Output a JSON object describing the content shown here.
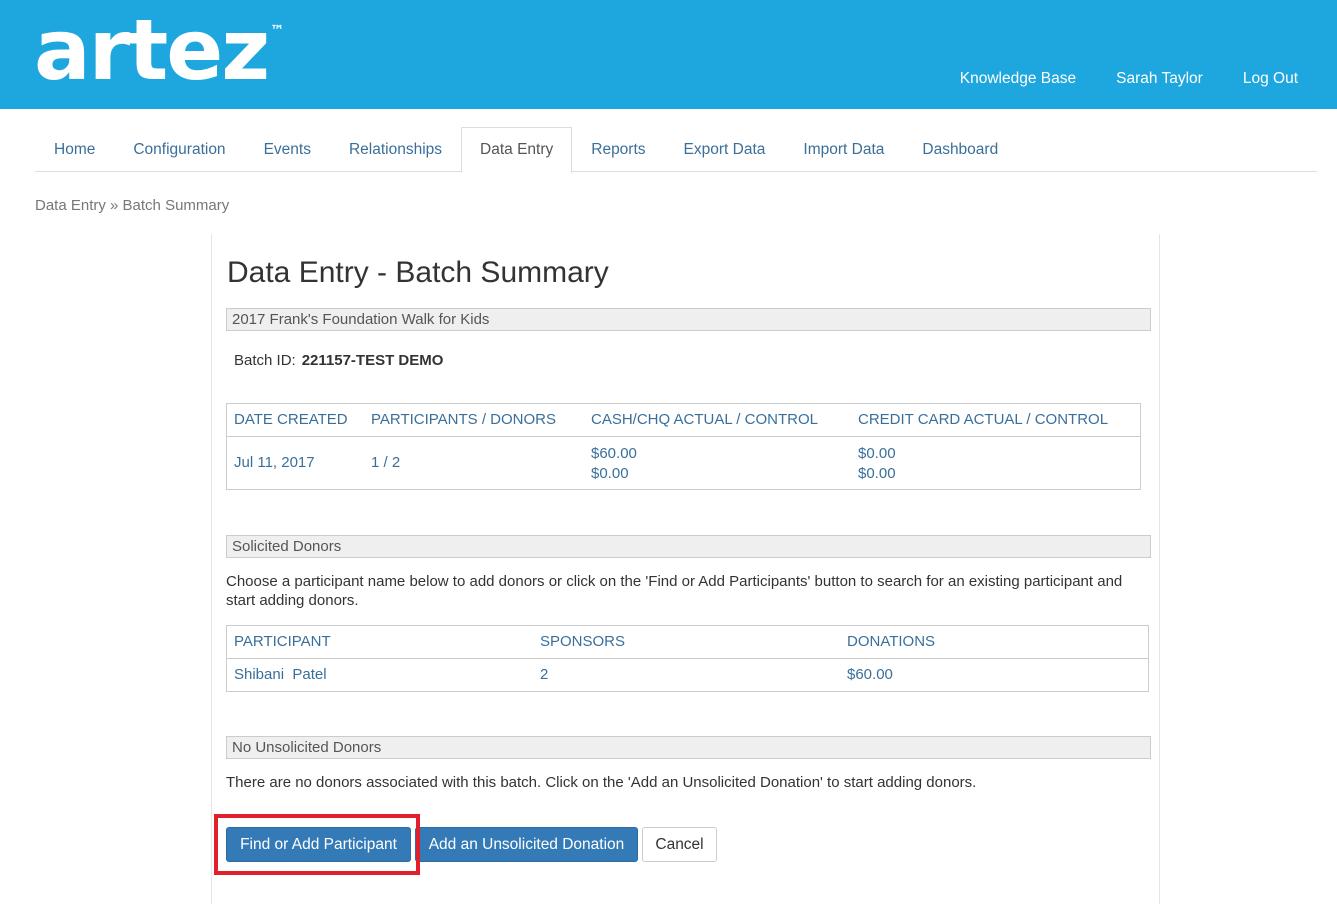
{
  "header": {
    "logo_text": "artez",
    "logo_tm": "™",
    "links": [
      "Knowledge Base",
      "Sarah Taylor",
      "Log Out"
    ]
  },
  "nav": {
    "tabs": [
      "Home",
      "Configuration",
      "Events",
      "Relationships",
      "Data Entry",
      "Reports",
      "Export Data",
      "Import Data",
      "Dashboard"
    ],
    "active": "Data Entry"
  },
  "breadcrumb": "Data Entry » Batch Summary",
  "page": {
    "title": "Data Entry - Batch Summary",
    "event_name": "2017 Frank's Foundation Walk for Kids",
    "batch_id_label": "Batch ID:",
    "batch_id_value": "221157-TEST DEMO"
  },
  "batch_table": {
    "headers": [
      "DATE CREATED",
      "PARTICIPANTS / DONORS",
      "CASH/CHQ ACTUAL / CONTROL",
      "CREDIT CARD ACTUAL / CONTROL"
    ],
    "row": {
      "date": "Jul 11, 2017",
      "participants_donors": "1 / 2",
      "cash_actual": "$60.00",
      "cash_control": "$0.00",
      "cc_actual": "$0.00",
      "cc_control": "$0.00"
    }
  },
  "solicited": {
    "heading": "Solicited Donors",
    "description": "Choose a participant name below to add donors or click on the 'Find or Add Participants' button to search for an existing participant and start adding donors.",
    "headers": [
      "PARTICIPANT",
      "SPONSORS",
      "DONATIONS"
    ],
    "rows": [
      {
        "participant": "Shibani  Patel",
        "sponsors": "2",
        "donations": "$60.00"
      }
    ]
  },
  "unsolicited": {
    "heading": "No Unsolicited Donors",
    "description": "There are no donors associated with this batch. Click on the 'Add an Unsolicited Donation' to start adding donors."
  },
  "buttons": {
    "find_add": "Find or Add Participant",
    "add_unsolicited": "Add an Unsolicited Donation",
    "cancel": "Cancel"
  },
  "colors": {
    "header_bg": "#1da7de",
    "link": "#3a6f9a",
    "primary_button": "#337ab7",
    "highlight": "#e0202a"
  }
}
